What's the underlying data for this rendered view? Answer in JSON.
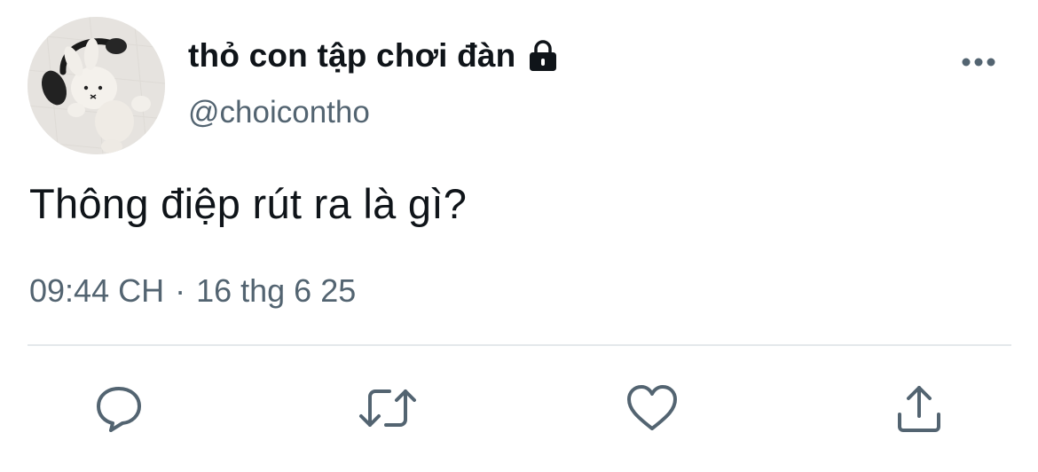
{
  "author": {
    "display_name": "thỏ con tập chơi đàn",
    "handle": "@choicontho",
    "protected_icon": "lock-icon",
    "avatar": "avatar-plush-bunny-with-headphones"
  },
  "tweet": {
    "text": "Thông điệp rút ra là gì?",
    "time": "09:44 CH",
    "separator": "·",
    "date": "16 thg 6 25"
  },
  "menu": {
    "icon": "more-horizontal-icon"
  },
  "actions": [
    {
      "name": "reply",
      "icon": "reply-icon"
    },
    {
      "name": "retweet",
      "icon": "retweet-icon"
    },
    {
      "name": "like",
      "icon": "heart-icon"
    },
    {
      "name": "share",
      "icon": "share-icon"
    }
  ],
  "colors": {
    "text_primary": "#0f1419",
    "text_secondary": "#536471",
    "divider": "#e4e8eb",
    "action_icon": "#536471"
  }
}
